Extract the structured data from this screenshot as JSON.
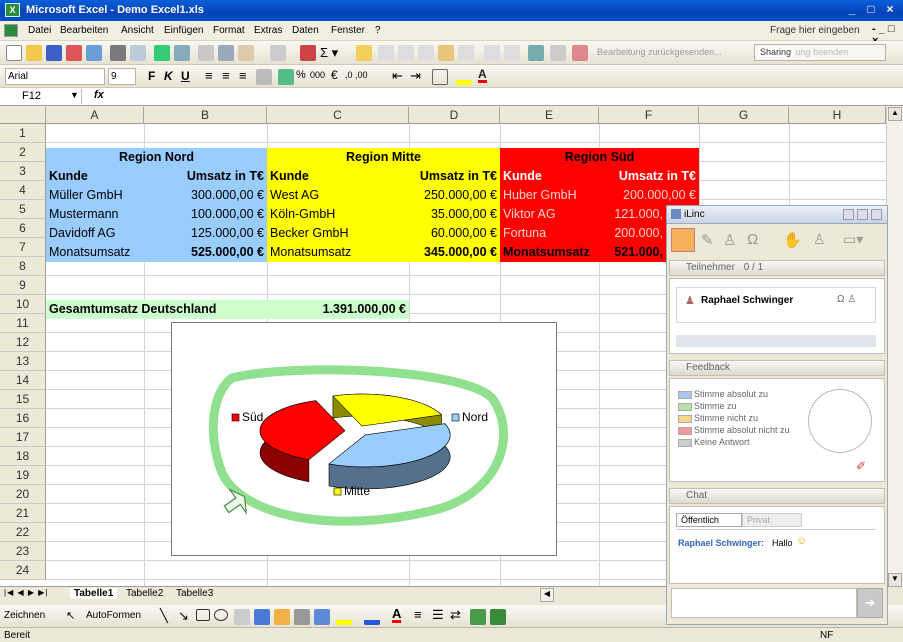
{
  "window": {
    "title": "Microsoft Excel - Demo Excel1.xls",
    "minimize": "_",
    "restore": "□",
    "close": "×"
  },
  "menu": {
    "items": [
      "Datei",
      "Bearbeiten",
      "Ansicht",
      "Einfügen",
      "Format",
      "Extras",
      "Daten",
      "Fenster",
      "?"
    ],
    "ask": "Frage hier eingeben"
  },
  "toolbar": {
    "font": "Arial",
    "size": "9",
    "review_text": "Bearbeitung zurückgesenden...",
    "sharing": "Sharing",
    "sharing_end": "ung beenden"
  },
  "formula": {
    "cell_ref": "F12",
    "fx": "fx",
    "value": ""
  },
  "columns": [
    "A",
    "B",
    "C",
    "D",
    "E",
    "F",
    "G",
    "H"
  ],
  "rows": [
    "1",
    "2",
    "3",
    "4",
    "5",
    "6",
    "7",
    "8",
    "9",
    "10",
    "11",
    "12",
    "13",
    "14",
    "15",
    "16",
    "17",
    "18",
    "19",
    "20",
    "21",
    "22",
    "23",
    "24"
  ],
  "regions": {
    "nord": {
      "title": "Region Nord",
      "color": "#99ccff",
      "header": [
        "Kunde",
        "Umsatz in T€"
      ],
      "rows": [
        [
          "Müller GmbH",
          "300.000,00 €"
        ],
        [
          "Mustermann",
          "100.000,00 €"
        ],
        [
          "Davidoff  AG",
          "125.000,00 €"
        ]
      ],
      "sum_label": "Monatsumsatz",
      "sum": "525.000,00 €"
    },
    "mitte": {
      "title": "Region Mitte",
      "color": "#ffff00",
      "header": [
        "Kunde",
        "Umsatz in T€"
      ],
      "rows": [
        [
          "West AG",
          "250.000,00 €"
        ],
        [
          "Köln-GmbH",
          "35.000,00 €"
        ],
        [
          "Becker GmbH",
          "60.000,00 €"
        ]
      ],
      "sum_label": "Monatsumsatz",
      "sum": "345.000,00 €"
    },
    "sued": {
      "title": "Region Süd",
      "color": "#ff0000",
      "header": [
        "Kunde",
        "Umsatz in T€"
      ],
      "rows": [
        [
          "Huber GmbH",
          "200.000,00 €"
        ],
        [
          "Viktor AG",
          "121.000,"
        ],
        [
          "Fortuna",
          "200.000,"
        ]
      ],
      "sum_label": "Monatsumsatz",
      "sum": "521.000,"
    }
  },
  "total": {
    "label": "Gesamtumsatz Deutschland",
    "value": "1.391.000,00 €",
    "color": "#ccffcc"
  },
  "chart_data": {
    "type": "pie",
    "categories": [
      "Süd",
      "Nord",
      "Mitte"
    ],
    "values": [
      521000,
      525000,
      345000
    ],
    "colors": [
      "#ff0000",
      "#99ccff",
      "#ffff00"
    ],
    "legend_labels": [
      "Süd",
      "Nord",
      "Mitte"
    ],
    "annotation_color": "#90e090"
  },
  "sheets": [
    "Tabelle1",
    "Tabelle2",
    "Tabelle3"
  ],
  "drawing": {
    "zeichnen": "Zeichnen",
    "autoformen": "AutoFormen"
  },
  "status": {
    "left": "Bereit",
    "right": "NF"
  },
  "ilinc": {
    "title": "iLinc",
    "participants": {
      "label": "Teilnehmer",
      "count": "0 / 1",
      "name": "Raphael Schwinger"
    },
    "feedback": {
      "label": "Feedback",
      "options": [
        "Stimme absolut zu",
        "Stimme zu",
        "Stimme nicht zu",
        "Stimme absolut nicht zu",
        "Keine Antwort"
      ],
      "colors": [
        "#a9c6ef",
        "#b8e3a6",
        "#f4d78a",
        "#f09a9a",
        "#cccccc"
      ]
    },
    "chat": {
      "label": "Chat",
      "tab_public": "Öffentlich",
      "tab_private": "Privat",
      "sender": "Raphael Schwinger:",
      "message": "Hallo",
      "emoji": "☺"
    }
  }
}
